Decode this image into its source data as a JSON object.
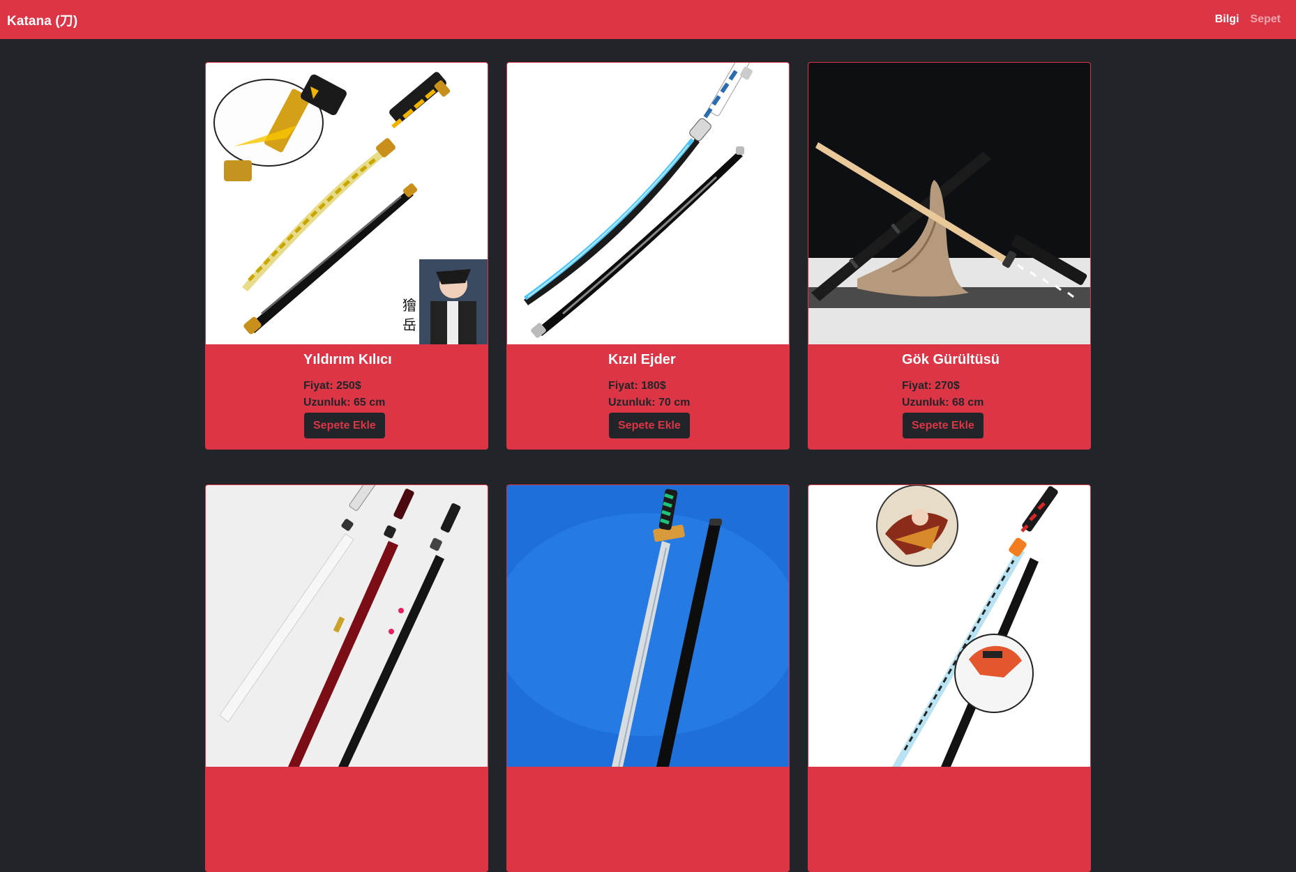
{
  "navbar": {
    "brand": "Katana (刀)",
    "links": [
      {
        "label": "Bilgi",
        "active": true
      },
      {
        "label": "Sepet",
        "active": false
      }
    ]
  },
  "products": [
    {
      "title": "Yıldırım Kılıcı",
      "price": "Fiyat: 250$",
      "length": "Uzunluk: 65 cm",
      "button": "Sepete Ekle",
      "image": "katana-yellow-lightning-icon"
    },
    {
      "title": "Kızıl Ejder",
      "price": "Fiyat: 180$",
      "length": "Uzunluk: 70 cm",
      "button": "Sepete Ekle",
      "image": "katana-blue-blade-icon"
    },
    {
      "title": "Gök Gürültüsü",
      "price": "Fiyat: 270$",
      "length": "Uzunluk: 68 cm",
      "button": "Sepete Ekle",
      "image": "katana-wooden-blade-icon"
    },
    {
      "image": "katana-trio-set-icon"
    },
    {
      "image": "katana-green-hilt-icon"
    },
    {
      "image": "katana-red-hilt-icon"
    }
  ],
  "colors": {
    "primary": "#dc3545",
    "background": "#212529",
    "card_text": "#212529",
    "title_text": "#ffffff"
  }
}
